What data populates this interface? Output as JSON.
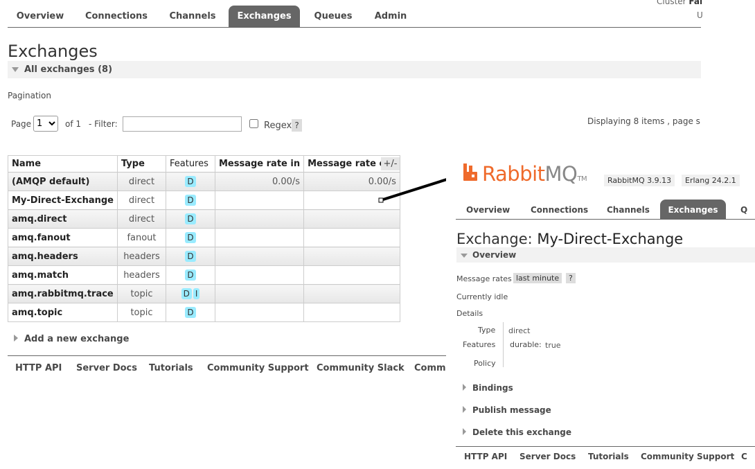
{
  "cluster": {
    "label": "Cluster",
    "value": "Fai",
    "user": "U"
  },
  "nav": {
    "tabs": [
      "Overview",
      "Connections",
      "Channels",
      "Exchanges",
      "Queues",
      "Admin"
    ],
    "active": "Exchanges"
  },
  "page": {
    "title": "Exchanges",
    "section": "All exchanges (8)"
  },
  "pagination": {
    "label": "Pagination",
    "page_label": "Page",
    "page_value": "1",
    "of_label": "of 1",
    "filter_label": "- Filter:",
    "filter_value": "",
    "regex_label": "Regex",
    "help": "?",
    "displaying": "Displaying 8 items , page s"
  },
  "table": {
    "headers": [
      "Name",
      "Type",
      "Features",
      "Message rate in",
      "Message rate out"
    ],
    "toggle": "+/-",
    "rows": [
      {
        "name": "(AMQP default)",
        "type": "direct",
        "features": [
          "D"
        ],
        "rate_in": "0.00/s",
        "rate_out": "0.00/s"
      },
      {
        "name": "My-Direct-Exchange",
        "type": "direct",
        "features": [
          "D"
        ],
        "rate_in": "",
        "rate_out": ""
      },
      {
        "name": "amq.direct",
        "type": "direct",
        "features": [
          "D"
        ],
        "rate_in": "",
        "rate_out": ""
      },
      {
        "name": "amq.fanout",
        "type": "fanout",
        "features": [
          "D"
        ],
        "rate_in": "",
        "rate_out": ""
      },
      {
        "name": "amq.headers",
        "type": "headers",
        "features": [
          "D"
        ],
        "rate_in": "",
        "rate_out": ""
      },
      {
        "name": "amq.match",
        "type": "headers",
        "features": [
          "D"
        ],
        "rate_in": "",
        "rate_out": ""
      },
      {
        "name": "amq.rabbitmq.trace",
        "type": "topic",
        "features": [
          "D",
          "I"
        ],
        "rate_in": "",
        "rate_out": ""
      },
      {
        "name": "amq.topic",
        "type": "topic",
        "features": [
          "D"
        ],
        "rate_in": "",
        "rate_out": ""
      }
    ]
  },
  "add_new": "Add a new exchange",
  "footer": [
    "HTTP API",
    "Server Docs",
    "Tutorials",
    "Community Support",
    "Community Slack",
    "Comme"
  ],
  "detail": {
    "logo_rabbit": "Rabbit",
    "logo_mq": "MQ",
    "logo_tm": "TM",
    "version": "RabbitMQ 3.9.13",
    "erlang": "Erlang 24.2.1",
    "tabs": [
      "Overview",
      "Connections",
      "Channels",
      "Exchanges",
      "Q"
    ],
    "title_prefix": "Exchange:",
    "title_name": "My-Direct-Exchange",
    "overview_label": "Overview",
    "message_rates_label": "Message rates",
    "message_rates_value": "last minute",
    "help": "?",
    "idle": "Currently idle",
    "details_label": "Details",
    "type_label": "Type",
    "type_value": "direct",
    "features_label": "Features",
    "features_key": "durable:",
    "features_value": "true",
    "policy_label": "Policy",
    "sections": [
      "Bindings",
      "Publish message",
      "Delete this exchange"
    ],
    "footer": [
      "HTTP API",
      "Server Docs",
      "Tutorials",
      "Community Support",
      "C"
    ]
  },
  "colors": {
    "accent": "#ef6a2b",
    "badge": "#99ebff",
    "active_tab": "#666666"
  }
}
